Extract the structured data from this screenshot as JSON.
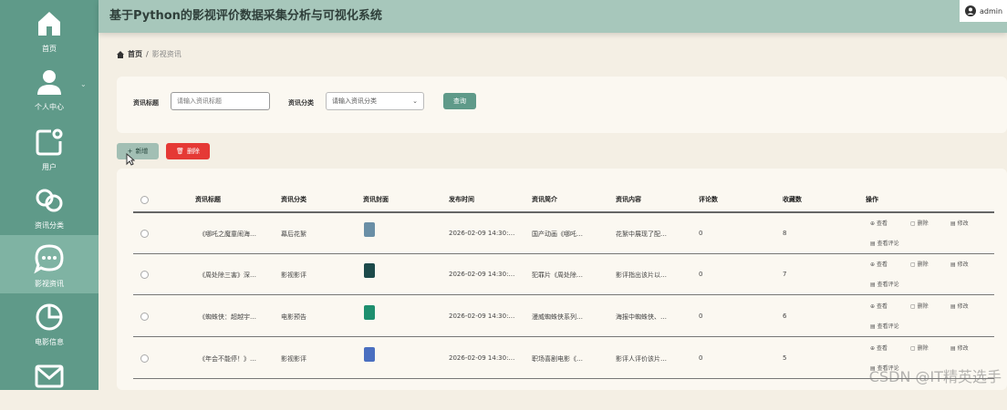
{
  "app": {
    "title": "基于Python的影视评价数据采集分析与可视化系统",
    "user": "admin"
  },
  "sidebar": {
    "items": [
      {
        "label": "首页",
        "icon": "home-icon"
      },
      {
        "label": "个人中心",
        "icon": "user-icon"
      },
      {
        "label": "用户",
        "icon": "edit-icon"
      },
      {
        "label": "资讯分类",
        "icon": "category-icon"
      },
      {
        "label": "影视资讯",
        "icon": "chat-icon",
        "active": true
      },
      {
        "label": "电影信息",
        "icon": "pie-chart-icon"
      },
      {
        "label": "",
        "icon": "mail-icon"
      }
    ]
  },
  "breadcrumb": {
    "home": "首页",
    "current": "影视资讯"
  },
  "search": {
    "title_label": "资讯标题",
    "title_placeholder": "请输入资讯标题",
    "category_label": "资讯分类",
    "category_placeholder": "请输入资讯分类",
    "search_button": "查询"
  },
  "actions": {
    "add": "新增",
    "delete": "删除"
  },
  "table": {
    "columns": [
      "资讯标题",
      "资讯分类",
      "资讯封面",
      "发布时间",
      "资讯简介",
      "资讯内容",
      "评论数",
      "收藏数",
      "操作"
    ],
    "rows": [
      {
        "title": "《哪吒之魔童闹海…",
        "category": "幕后花絮",
        "time": "2026-02-09 14:30:…",
        "intro": "国产动画《哪吒…",
        "content": "花絮中展现了配…",
        "comments": "0",
        "favorites": "8",
        "cover_color": "#6a8fa6"
      },
      {
        "title": "《周处除三害》深…",
        "category": "影视影评",
        "time": "2026-02-09 14:30:…",
        "intro": "犯罪片《周处除…",
        "content": "影评指出该片以…",
        "comments": "0",
        "favorites": "7",
        "cover_color": "#1c4a4a"
      },
      {
        "title": "《蜘蛛侠：超越宇…",
        "category": "电影预告",
        "time": "2026-02-09 14:30:…",
        "intro": "漫威蜘蛛侠系列…",
        "content": "海报中蜘蛛侠、…",
        "comments": "0",
        "favorites": "6",
        "cover_color": "#1e8f6e"
      },
      {
        "title": "《年会不能停！》…",
        "category": "影视影评",
        "time": "2026-02-09 14:30:…",
        "intro": "职场喜剧电影《…",
        "content": "影评人评价该片…",
        "comments": "0",
        "favorites": "5",
        "cover_color": "#4a6fc0"
      }
    ],
    "ops": {
      "view": "查看",
      "delete": "删除",
      "edit": "修改",
      "review": "查看评论"
    }
  },
  "watermark": "CSDN @IT精英选手",
  "colors": {
    "sidebar": "#5f9a89",
    "topbar": "#a7c7bb",
    "danger": "#e53935",
    "accent": "#5f9a89"
  }
}
